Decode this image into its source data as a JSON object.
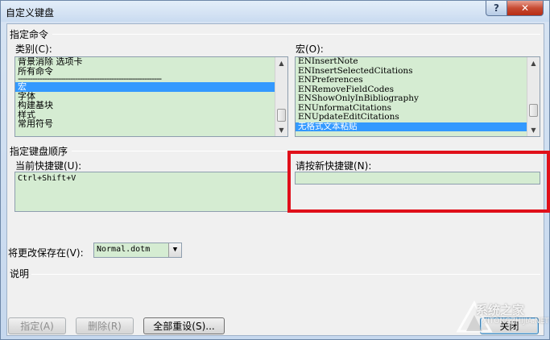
{
  "window": {
    "title": "自定义键盘",
    "help_label": "?",
    "close_label": "✕"
  },
  "commands": {
    "group_label": "指定命令",
    "categories_label": "类别(C):",
    "categories": [
      {
        "label": "背景消除 选项卡",
        "selected": false
      },
      {
        "label": "所有命令",
        "selected": false
      },
      {
        "label": "------------------------------------------------------------",
        "selected": false,
        "divider": true
      },
      {
        "label": "宏",
        "selected": true
      },
      {
        "label": "字体",
        "selected": false
      },
      {
        "label": "构建基块",
        "selected": false
      },
      {
        "label": "样式",
        "selected": false
      },
      {
        "label": "常用符号",
        "selected": false
      }
    ],
    "macros_label": "宏(O):",
    "macros": [
      {
        "label": "ENInsertNote",
        "selected": false
      },
      {
        "label": "ENInsertSelectedCitations",
        "selected": false
      },
      {
        "label": "ENPreferences",
        "selected": false
      },
      {
        "label": "ENRemoveFieldCodes",
        "selected": false
      },
      {
        "label": "ENShowOnlyInBibliography",
        "selected": false
      },
      {
        "label": "ENUnformatCitations",
        "selected": false
      },
      {
        "label": "ENUpdateEditCitations",
        "selected": false
      },
      {
        "label": "无格式文本粘贴",
        "selected": true
      }
    ]
  },
  "keyboard": {
    "group_label": "指定键盘顺序",
    "current_keys_label": "当前快捷键(U):",
    "current_keys": [
      "Ctrl+Shift+V"
    ],
    "new_key_label": "请按新快捷键(N):",
    "new_key_value": ""
  },
  "save_in": {
    "label": "将更改保存在(V):",
    "value": "Normal.dotm"
  },
  "description": {
    "label": "说明"
  },
  "buttons": {
    "assign": "指定(A)",
    "remove": "删除(R)",
    "reset_all": "全部重设(S)...",
    "close": "关闭"
  },
  "watermark": {
    "text": "系统之家",
    "sub": "XITONGZHIJIA.NET"
  },
  "colors": {
    "list_bg": "#d5ecd2",
    "selection": "#3399ff",
    "highlight_box": "#e0101a"
  }
}
